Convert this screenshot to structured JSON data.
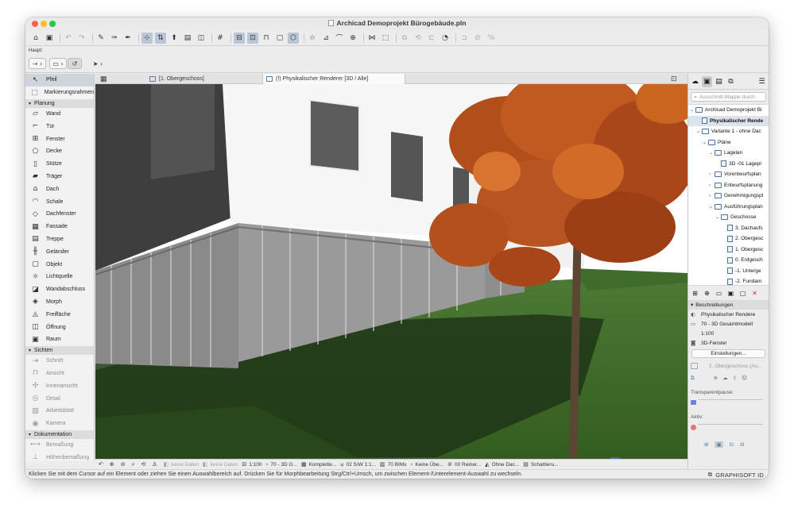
{
  "window": {
    "title": "Archicad Demoprojekt Bürogebäude.pln",
    "traffic_colors": [
      "#fe5f57",
      "#febc2e",
      "#28c840"
    ]
  },
  "toolbar": {
    "icons": [
      "home-icon",
      "save-icon",
      "sep",
      "undo-icon",
      "redo-icon",
      "sep",
      "pick-up-icon",
      "eyedropper-icon",
      "inject-icon",
      "sep",
      "snap-icon",
      "walk-icon",
      "arrow-select-icon",
      "trace-icon",
      "layer-icon",
      "sep",
      "grid-icon",
      "sep",
      "display-icon",
      "guide-icon",
      "lock-icon",
      "group-icon",
      "render-icon",
      "sep",
      "star-icon",
      "3d-edit-icon",
      "curve-icon",
      "distance-icon",
      "sep",
      "edge-icon",
      "explode-icon",
      "sep",
      "mirror-icon",
      "rotate-icon",
      "align-icon",
      "fill-icon",
      "sep",
      "offset-icon",
      "cut-icon",
      "percent-icon"
    ]
  },
  "infobox": {
    "label": "Haupt:",
    "buttons": [
      "⇢ ›",
      "▭ ›",
      "↺",
      "➤ ›"
    ]
  },
  "toolbox": {
    "top": [
      {
        "label": "Pfeil",
        "icon": "arrow-icon",
        "glyph": "↖",
        "selected": true
      },
      {
        "label": "Markierungsrahmen",
        "icon": "marquee-icon",
        "glyph": "⬚"
      }
    ],
    "sections": [
      {
        "title": "Planung",
        "items": [
          {
            "label": "Wand",
            "icon": "wall-icon",
            "glyph": "▱"
          },
          {
            "label": "Tür",
            "icon": "door-icon",
            "glyph": "⌐"
          },
          {
            "label": "Fenster",
            "icon": "window-icon",
            "glyph": "⊞"
          },
          {
            "label": "Decke",
            "icon": "slab-icon",
            "glyph": "⬠"
          },
          {
            "label": "Stütze",
            "icon": "column-icon",
            "glyph": "▯"
          },
          {
            "label": "Träger",
            "icon": "beam-icon",
            "glyph": "▰"
          },
          {
            "label": "Dach",
            "icon": "roof-icon",
            "glyph": "⌂"
          },
          {
            "label": "Schale",
            "icon": "shell-icon",
            "glyph": "◠"
          },
          {
            "label": "Dachfenster",
            "icon": "skylight-icon",
            "glyph": "◇"
          },
          {
            "label": "Fassade",
            "icon": "curtain-wall-icon",
            "glyph": "▦"
          },
          {
            "label": "Treppe",
            "icon": "stair-icon",
            "glyph": "▤"
          },
          {
            "label": "Geländer",
            "icon": "railing-icon",
            "glyph": "╫"
          },
          {
            "label": "Objekt",
            "icon": "object-icon",
            "glyph": "▢"
          },
          {
            "label": "Lichtquelle",
            "icon": "lamp-icon",
            "glyph": "☼"
          },
          {
            "label": "Wandabschluss",
            "icon": "wall-end-icon",
            "glyph": "◪"
          },
          {
            "label": "Morph",
            "icon": "morph-icon",
            "glyph": "◈"
          },
          {
            "label": "Freifläche",
            "icon": "mesh-icon",
            "glyph": "◬"
          },
          {
            "label": "Öffnung",
            "icon": "opening-icon",
            "glyph": "◫"
          },
          {
            "label": "Raum",
            "icon": "zone-icon",
            "glyph": "▣"
          }
        ]
      },
      {
        "title": "Sichten",
        "items": [
          {
            "label": "Schnitt",
            "icon": "section-icon",
            "glyph": "⇥",
            "grey": true
          },
          {
            "label": "Ansicht",
            "icon": "elevation-icon",
            "glyph": "⊓",
            "grey": true
          },
          {
            "label": "Innenansicht",
            "icon": "interior-elevation-icon",
            "glyph": "✣",
            "grey": true
          },
          {
            "label": "Detail",
            "icon": "detail-icon",
            "glyph": "◎",
            "grey": true
          },
          {
            "label": "Arbeitsblatt",
            "icon": "worksheet-icon",
            "glyph": "▧",
            "grey": true
          },
          {
            "label": "Kamera",
            "icon": "camera-icon",
            "glyph": "◉",
            "grey": true
          }
        ]
      },
      {
        "title": "Dokumentation",
        "items": [
          {
            "label": "Bemaßung",
            "icon": "dimension-icon",
            "glyph": "⟷",
            "grey": true
          },
          {
            "label": "Höhenbemaßung",
            "icon": "level-dimension-icon",
            "glyph": "⊥",
            "grey": true
          }
        ]
      }
    ]
  },
  "tabs": [
    {
      "label": "[1. Obergeschoss]",
      "active": false
    },
    {
      "label": "(!) Physikalischer Renderer [3D / Alle]",
      "active": true
    }
  ],
  "statusbar": {
    "items": [
      {
        "text": "keine Daten",
        "grey": true,
        "glyph": "◧"
      },
      {
        "text": "keine Daten",
        "grey": true,
        "glyph": "◧"
      },
      {
        "text": "1:100",
        "glyph": "⊟"
      },
      {
        "text": "70 - 3D G...",
        "glyph": "›"
      },
      {
        "text": "Komplette...",
        "glyph": "▦"
      },
      {
        "text": "02 S/W 1:1...",
        "glyph": "⍦"
      },
      {
        "text": "70 BIMx",
        "glyph": "▥"
      },
      {
        "text": "Keine Übe...",
        "glyph": "›"
      },
      {
        "text": "00 Reiner...",
        "glyph": "⊘"
      },
      {
        "text": "Ohne Dac...",
        "glyph": "◭"
      },
      {
        "text": "Schattieru...",
        "glyph": "▤"
      }
    ]
  },
  "hint": "Klicken Sie mit dem Cursor auf ein Element oder ziehen Sie einen Auswahlbereich auf. Drücken Sie für Morphbearbeitung Strg/Ctrl+Umsch, um zwischen Element-/Unterelement-Auswahl zu wechseln.",
  "brand": "GRAPHISOFT ID",
  "navigator": {
    "search_placeholder": "Ausschnitt-Mappe durch",
    "tree": [
      {
        "label": "Archicad Demoprojekt Bi",
        "indent": 0,
        "arrow": "⌄",
        "icon": "project",
        "sel": false
      },
      {
        "label": "Physikalischer Rende",
        "indent": 1,
        "arrow": "",
        "icon": "page",
        "sel": true
      },
      {
        "label": "Variante 1 - ohne Dac",
        "indent": 1,
        "arrow": "⌄",
        "icon": "folder",
        "sel": false
      },
      {
        "label": "Pläne",
        "indent": 2,
        "arrow": "⌄",
        "icon": "folder",
        "sel": false
      },
      {
        "label": "Lagelan",
        "indent": 3,
        "arrow": "⌄",
        "icon": "folder",
        "sel": false
      },
      {
        "label": "3D -01 Lagepl",
        "indent": 4,
        "arrow": "",
        "icon": "page",
        "sel": false
      },
      {
        "label": "Vorentwurfsplan",
        "indent": 3,
        "arrow": "›",
        "icon": "folder",
        "sel": false
      },
      {
        "label": "Entwurfsplanung",
        "indent": 3,
        "arrow": "›",
        "icon": "folder",
        "sel": false
      },
      {
        "label": "Genehmigungspl",
        "indent": 3,
        "arrow": "›",
        "icon": "folder",
        "sel": false
      },
      {
        "label": "Ausführungsplan",
        "indent": 3,
        "arrow": "⌄",
        "icon": "folder",
        "sel": false
      },
      {
        "label": "Geschosse",
        "indent": 4,
        "arrow": "⌄",
        "icon": "folder",
        "sel": false
      },
      {
        "label": "3. Dachaufs",
        "indent": 5,
        "arrow": "",
        "icon": "page",
        "sel": false
      },
      {
        "label": "2. Obergesc",
        "indent": 5,
        "arrow": "",
        "icon": "page",
        "sel": false
      },
      {
        "label": "1. Obergesc",
        "indent": 5,
        "arrow": "",
        "icon": "page",
        "sel": false
      },
      {
        "label": "0. Erdgesch",
        "indent": 5,
        "arrow": "",
        "icon": "page",
        "sel": false
      },
      {
        "label": "-1. Unterge",
        "indent": 5,
        "arrow": "",
        "icon": "page",
        "sel": false
      },
      {
        "label": "-2. Fundam",
        "indent": 5,
        "arrow": "",
        "icon": "page",
        "sel": false
      }
    ],
    "props_header": "Beschreibungen",
    "props": [
      {
        "icon": "link-icon",
        "glyph": "◐",
        "text": "Physikalischer Rendere"
      },
      {
        "icon": "view-icon",
        "glyph": "▭",
        "text": "70 - 3D Gesamtmodell"
      },
      {
        "icon": "scale-icon",
        "glyph": "",
        "text": "1:100"
      },
      {
        "icon": "camera-icon",
        "glyph": "◙",
        "text": "3D-Fenster"
      }
    ],
    "settings_button": "Einstellungen...",
    "layout_label": "2. Obergeschoss (Au...",
    "transparent_label": "Transparentpause:",
    "active_label": "Aktiv:"
  }
}
